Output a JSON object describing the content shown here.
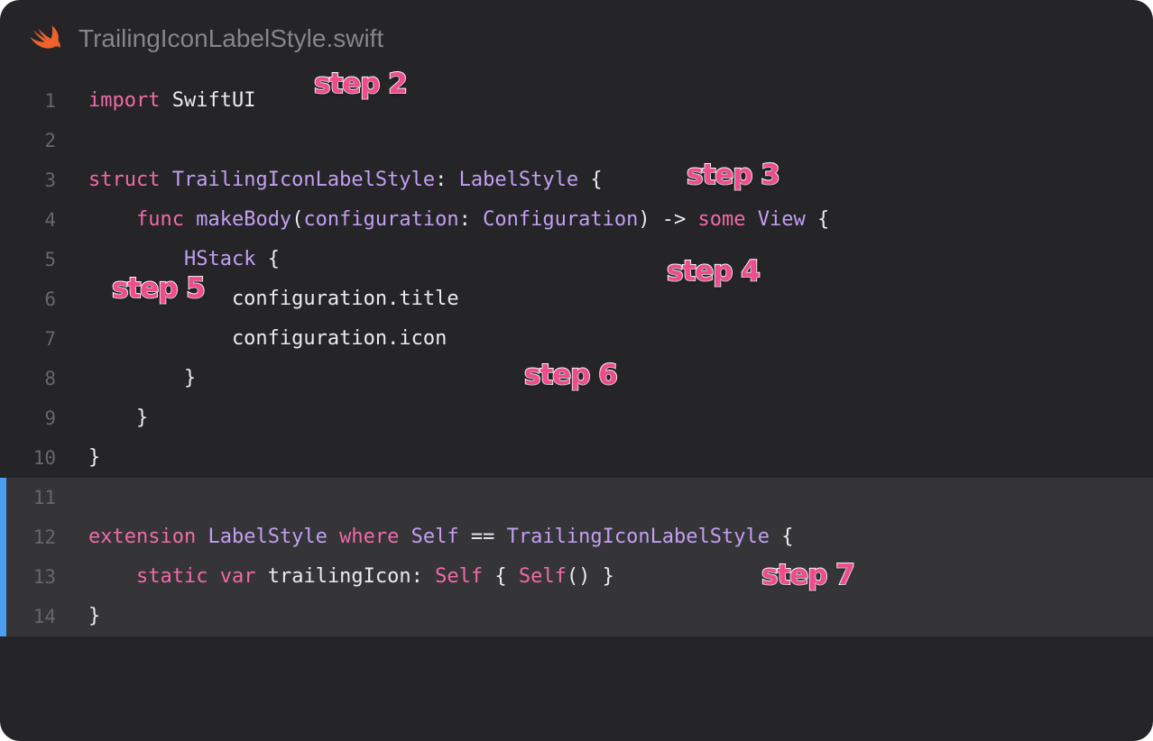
{
  "window": {
    "filename": "TrailingIconLabelStyle.swift",
    "file_icon": "swift-icon"
  },
  "colors": {
    "background": "#252528",
    "highlight_background": "#353538",
    "highlight_bar": "#4a9ff4",
    "keyword": "#ef6aa7",
    "type": "#c29ff2",
    "plain": "#ececee",
    "line_number": "#66666b",
    "step_badge": "#f04b8c"
  },
  "code": {
    "lines": [
      {
        "number": "1",
        "highlighted": false,
        "tokens": [
          [
            "kw",
            "import"
          ],
          [
            "pl",
            " SwiftUI"
          ]
        ]
      },
      {
        "number": "2",
        "highlighted": false,
        "tokens": []
      },
      {
        "number": "3",
        "highlighted": false,
        "tokens": [
          [
            "kw",
            "struct"
          ],
          [
            "pl",
            " "
          ],
          [
            "ty",
            "TrailingIconLabelStyle"
          ],
          [
            "pl",
            ": "
          ],
          [
            "ty",
            "LabelStyle"
          ],
          [
            "pl",
            " {"
          ]
        ]
      },
      {
        "number": "4",
        "highlighted": false,
        "tokens": [
          [
            "pl",
            "    "
          ],
          [
            "kw",
            "func"
          ],
          [
            "pl",
            " "
          ],
          [
            "ty",
            "makeBody"
          ],
          [
            "pl",
            "("
          ],
          [
            "ty",
            "configuration"
          ],
          [
            "pl",
            ": "
          ],
          [
            "ty",
            "Configuration"
          ],
          [
            "pl",
            ") -> "
          ],
          [
            "kw",
            "some"
          ],
          [
            "pl",
            " "
          ],
          [
            "ty",
            "View"
          ],
          [
            "pl",
            " {"
          ]
        ]
      },
      {
        "number": "5",
        "highlighted": false,
        "tokens": [
          [
            "pl",
            "        "
          ],
          [
            "ty",
            "HStack"
          ],
          [
            "pl",
            " {"
          ]
        ]
      },
      {
        "number": "6",
        "highlighted": false,
        "tokens": [
          [
            "pl",
            "            configuration.title"
          ]
        ]
      },
      {
        "number": "7",
        "highlighted": false,
        "tokens": [
          [
            "pl",
            "            configuration.icon"
          ]
        ]
      },
      {
        "number": "8",
        "highlighted": false,
        "tokens": [
          [
            "pl",
            "        }"
          ]
        ]
      },
      {
        "number": "9",
        "highlighted": false,
        "tokens": [
          [
            "pl",
            "    }"
          ]
        ]
      },
      {
        "number": "10",
        "highlighted": false,
        "tokens": [
          [
            "pl",
            "}"
          ]
        ]
      },
      {
        "number": "11",
        "highlighted": true,
        "tokens": []
      },
      {
        "number": "12",
        "highlighted": true,
        "tokens": [
          [
            "kw",
            "extension"
          ],
          [
            "pl",
            " "
          ],
          [
            "ty",
            "LabelStyle"
          ],
          [
            "pl",
            " "
          ],
          [
            "kw",
            "where"
          ],
          [
            "pl",
            " "
          ],
          [
            "ty",
            "Self"
          ],
          [
            "pl",
            " == "
          ],
          [
            "ty",
            "TrailingIconLabelStyle"
          ],
          [
            "pl",
            " {"
          ]
        ]
      },
      {
        "number": "13",
        "highlighted": true,
        "tokens": [
          [
            "pl",
            "    "
          ],
          [
            "kw",
            "static"
          ],
          [
            "pl",
            " "
          ],
          [
            "kw",
            "var"
          ],
          [
            "pl",
            " trailingIcon: "
          ],
          [
            "kw",
            "Self"
          ],
          [
            "pl",
            " { "
          ],
          [
            "kw",
            "Self"
          ],
          [
            "pl",
            "() }"
          ]
        ]
      },
      {
        "number": "14",
        "highlighted": true,
        "tokens": [
          [
            "pl",
            "}"
          ]
        ]
      }
    ]
  },
  "steps": {
    "step2": "step 2",
    "step3": "step 3",
    "step4": "step 4",
    "step5": "step 5",
    "step6": "step 6",
    "step7": "step 7"
  }
}
